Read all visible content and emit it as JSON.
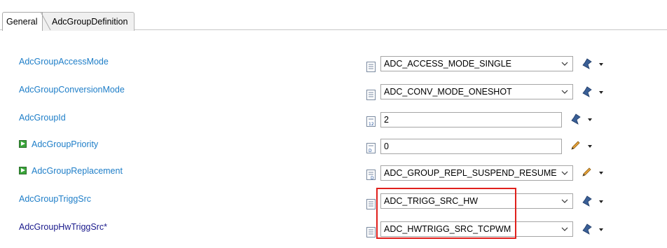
{
  "tabs": [
    {
      "label": "General"
    },
    {
      "label": "AdcGroupDefinition"
    }
  ],
  "rows": [
    {
      "label": "AdcGroupAccessMode",
      "value": "ADC_ACCESS_MODE_SINGLE"
    },
    {
      "label": "AdcGroupConversionMode",
      "value": "ADC_CONV_MODE_ONESHOT"
    },
    {
      "label": "AdcGroupId",
      "value": "2"
    },
    {
      "label": "AdcGroupPriority",
      "value": "0"
    },
    {
      "label": "AdcGroupReplacement",
      "value": "ADC_GROUP_REPL_SUSPEND_RESUME"
    },
    {
      "label": "AdcGroupTriggSrc",
      "value": "ADC_TRIGG_SRC_HW"
    },
    {
      "label": "AdcGroupHwTriggSrc*",
      "value": "ADC_HWTRIGG_SRC_TCPWM"
    }
  ],
  "colors": {
    "label": "#1e7ec8",
    "required_label": "#1a1a8c",
    "highlight": "#e0201c"
  },
  "icons": {
    "document": "document-icon",
    "number": "number-icon",
    "config": "config-edit-icon",
    "pencil": "pencil-edit-icon",
    "play": "enabled-param-icon",
    "dropdown": "chevron-down-icon"
  }
}
